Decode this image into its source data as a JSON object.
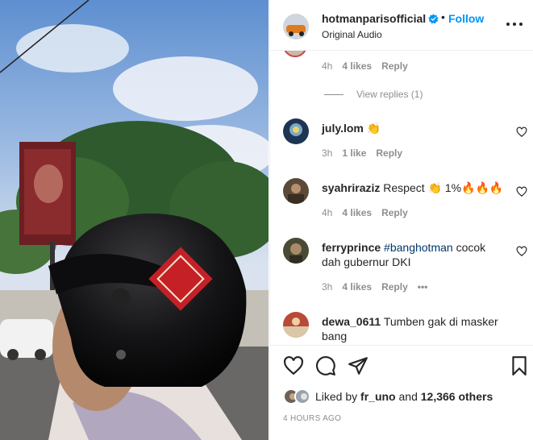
{
  "header": {
    "username": "hotmanparisofficial",
    "separator": "•",
    "follow_label": "Follow",
    "subtitle": "Original Audio"
  },
  "first_comment_meta": {
    "time": "4h",
    "likes": "4 likes",
    "reply": "Reply"
  },
  "view_replies": "View replies (1)",
  "comments": [
    {
      "username": "july.lom",
      "text": "👏",
      "time": "3h",
      "likes": "1 like",
      "reply": "Reply"
    },
    {
      "username": "syahriraziz",
      "text": "Respect 👏 1%🔥🔥🔥",
      "time": "4h",
      "likes": "4 likes",
      "reply": "Reply"
    },
    {
      "username": "ferryprince",
      "tag": "#banghotman",
      "text": "cocok dah gubernur DKI",
      "time": "3h",
      "likes": "4 likes",
      "reply": "Reply",
      "more": "•••"
    },
    {
      "username": "dewa_0611",
      "text": "Tumben gak di masker bang"
    }
  ],
  "liked_by": {
    "prefix": "Liked by",
    "user": "fr_uno",
    "and": "and",
    "others": "12,366 others"
  },
  "timestamp": "4 HOURS AGO",
  "icons": [
    "verified-icon",
    "more-options-icon",
    "heart-icon",
    "comment-icon",
    "share-icon",
    "bookmark-icon"
  ],
  "colors": {
    "follow": "#0095f6",
    "meta": "#8e8e8e",
    "text": "#262626",
    "hashtag": "#00376b"
  }
}
